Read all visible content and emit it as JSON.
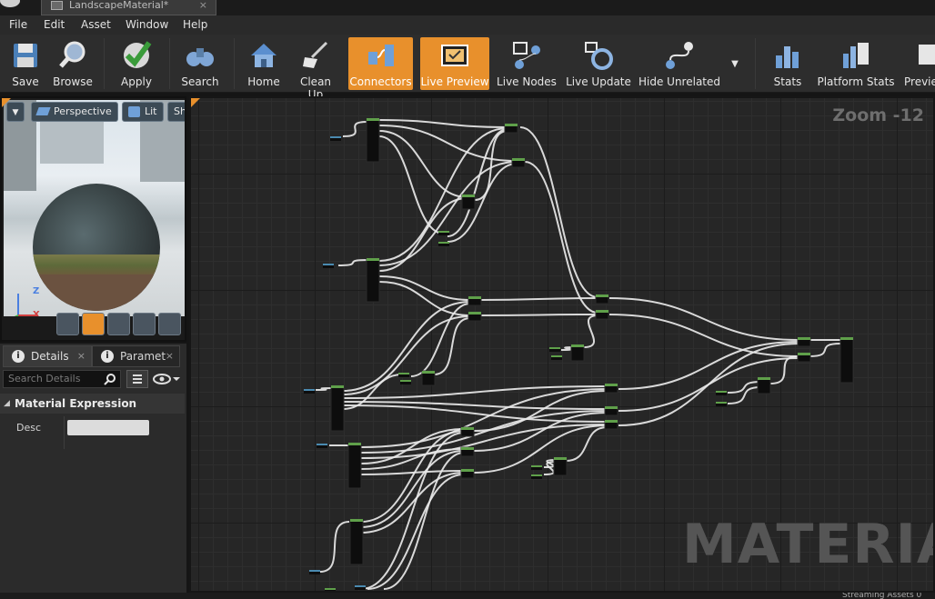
{
  "tab": {
    "title": "LandscapeMaterial*",
    "close": "×"
  },
  "menu": [
    "File",
    "Edit",
    "Asset",
    "Window",
    "Help"
  ],
  "toolbar": {
    "save": "Save",
    "browse": "Browse",
    "apply": "Apply",
    "search": "Search",
    "home": "Home",
    "clean_up": "Clean Up",
    "connectors": "Connectors",
    "live_preview": "Live Preview",
    "live_nodes": "Live Nodes",
    "live_update": "Live Update",
    "hide_unrelated": "Hide Unrelated",
    "stats": "Stats",
    "platform_stats": "Platform Stats",
    "preview": "Previe"
  },
  "viewport": {
    "perspective": "Perspective",
    "lit": "Lit",
    "show": "Sh",
    "axis_z": "Z",
    "axis_x": "X"
  },
  "details": {
    "tab_details": "Details",
    "tab_parameters": "Paramet",
    "close": "×",
    "search_placeholder": "Search Details",
    "section": "Material Expression",
    "desc_label": "Desc"
  },
  "graph": {
    "zoom": "Zoom -12",
    "watermark": "MATERIAL"
  },
  "status": {
    "text": "Streaming Assets 0"
  },
  "colors": {
    "accent": "#e8902c",
    "pin_green": "#5fa04a",
    "pin_blue": "#4a8ab0",
    "wire": "#e8e8e8"
  }
}
